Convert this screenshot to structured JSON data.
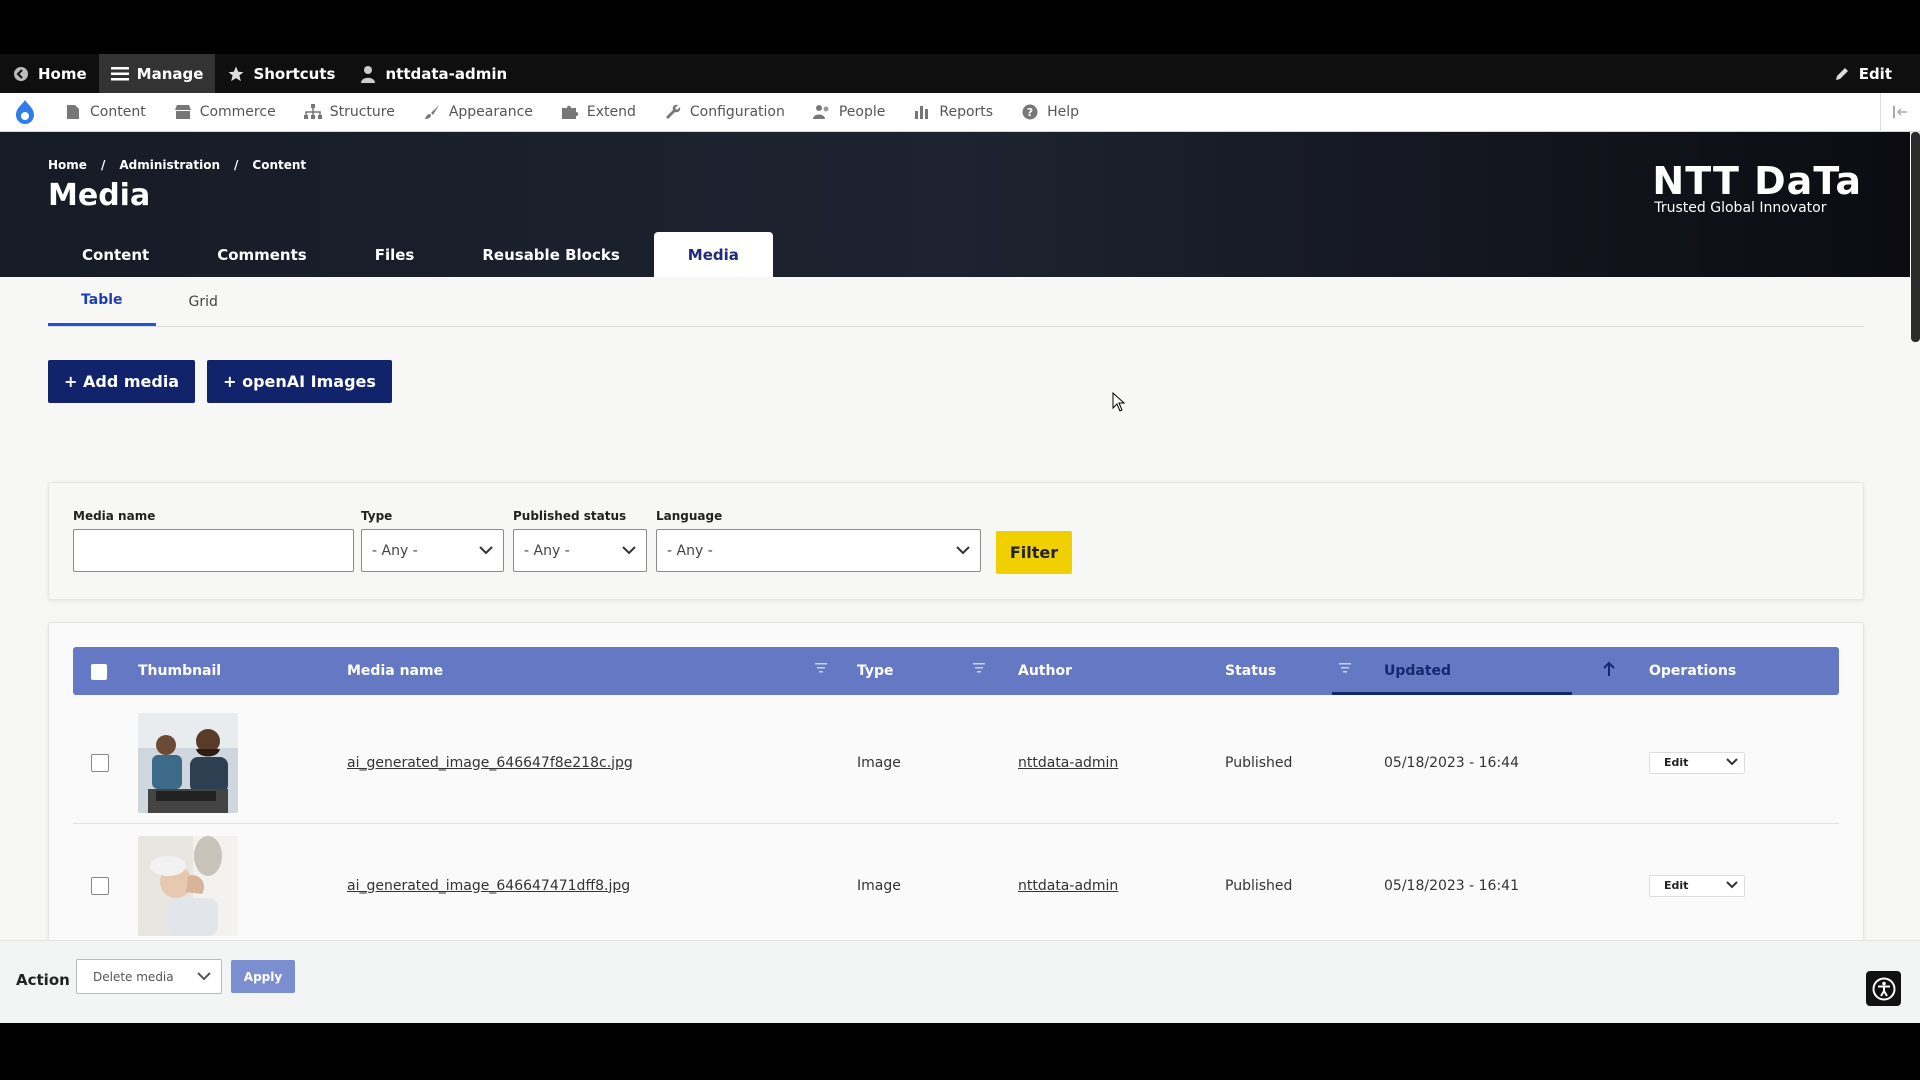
{
  "toolbar": {
    "home": "Home",
    "manage": "Manage",
    "shortcuts": "Shortcuts",
    "user": "nttdata-admin",
    "edit": "Edit"
  },
  "tray": {
    "items": [
      "Content",
      "Commerce",
      "Structure",
      "Appearance",
      "Extend",
      "Configuration",
      "People",
      "Reports",
      "Help"
    ]
  },
  "header": {
    "breadcrumb": [
      "Home",
      "Administration",
      "Content"
    ],
    "title": "Media",
    "brand_name": "NTT DaTa",
    "brand_tagline": "Trusted Global Innovator",
    "tabs": [
      "Content",
      "Comments",
      "Files",
      "Reusable Blocks",
      "Media"
    ],
    "active_tab": "Media"
  },
  "secondary_tabs": [
    "Table",
    "Grid"
  ],
  "buttons": {
    "add_media": "+ Add media",
    "openai_images": "+ openAI Images"
  },
  "filters": {
    "media_name_label": "Media name",
    "media_name_value": "",
    "type_label": "Type",
    "type_value": "- Any -",
    "published_label": "Published status",
    "published_value": "- Any -",
    "language_label": "Language",
    "language_value": "- Any -",
    "filter_button": "Filter"
  },
  "table": {
    "columns": [
      "Thumbnail",
      "Media name",
      "Type",
      "Author",
      "Status",
      "Updated",
      "Operations"
    ],
    "rows": [
      {
        "name": "ai_generated_image_646647f8e218c.jpg",
        "type": "Image",
        "author": "nttdata-admin",
        "status": "Published",
        "updated": "05/18/2023 - 16:44",
        "op": "Edit"
      },
      {
        "name": "ai_generated_image_646647471dff8.jpg",
        "type": "Image",
        "author": "nttdata-admin",
        "status": "Published",
        "updated": "05/18/2023 - 16:41",
        "op": "Edit"
      }
    ]
  },
  "bulk": {
    "label": "Action",
    "select_value": "Delete media",
    "apply": "Apply"
  },
  "colors": {
    "accent_dark": "#11246b",
    "table_header": "#6478c4",
    "filter_button": "#f0d000"
  }
}
